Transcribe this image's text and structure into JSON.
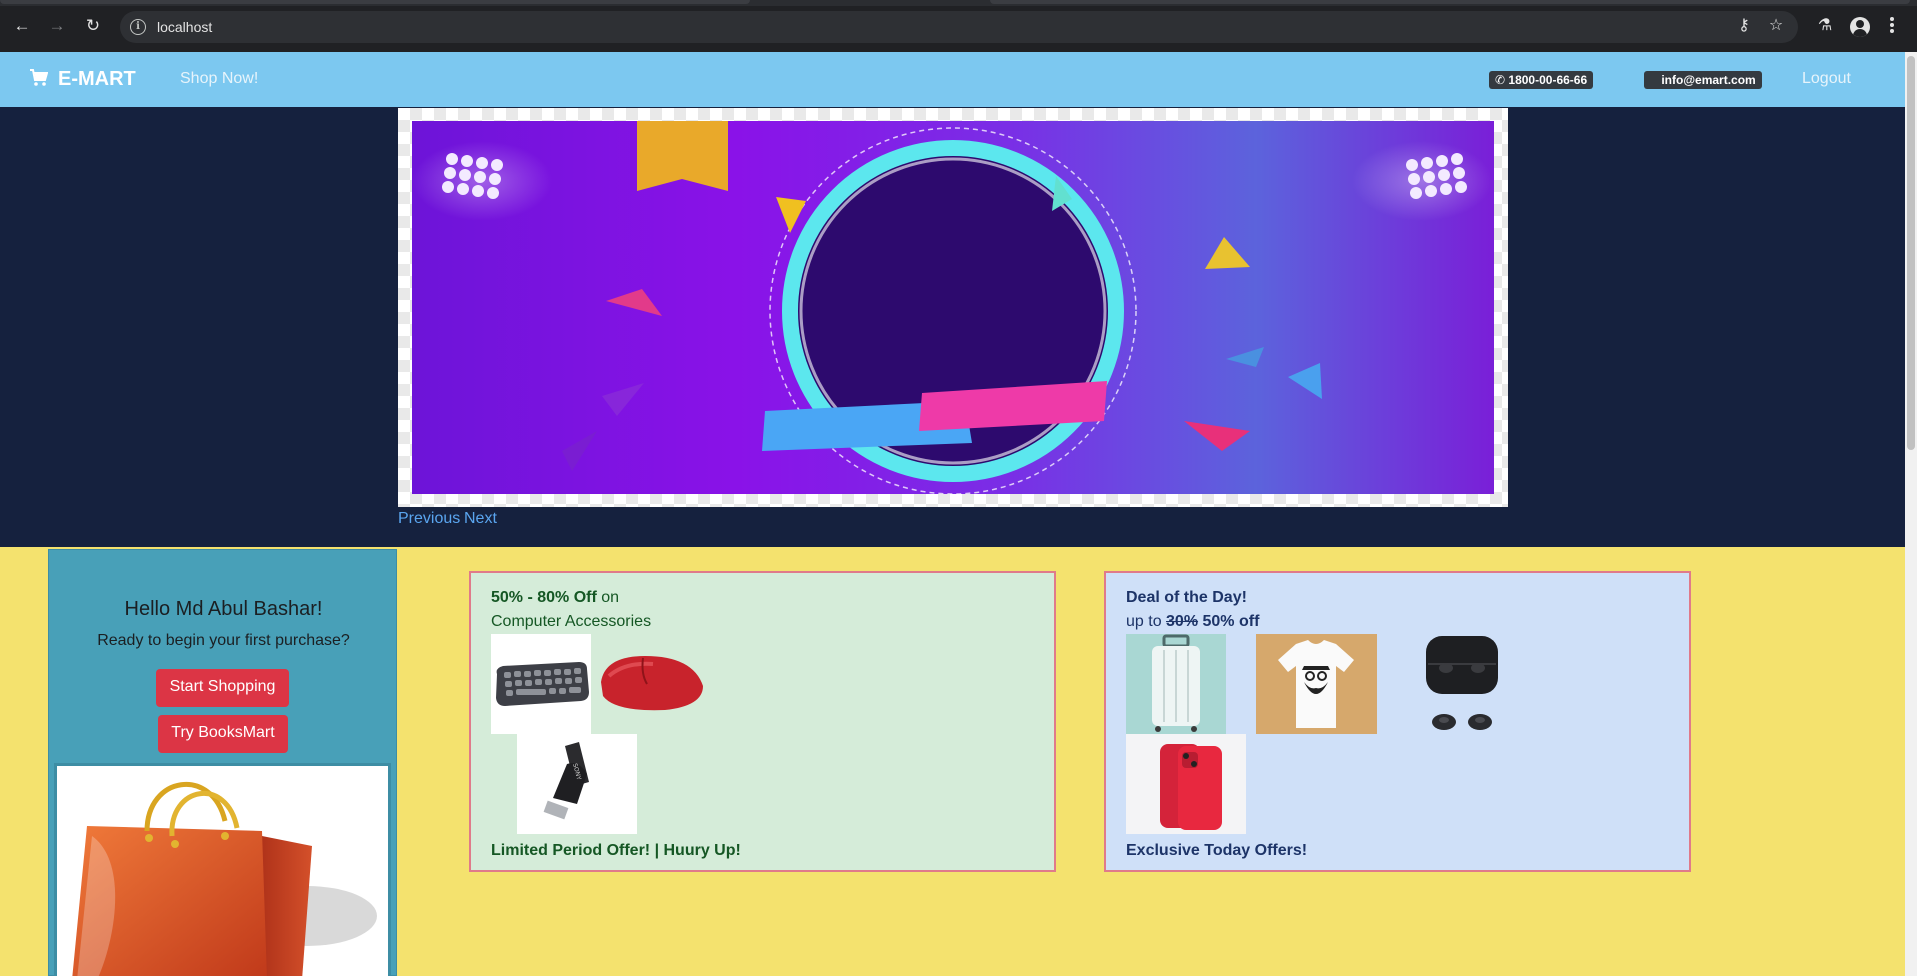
{
  "browser": {
    "url": "localhost"
  },
  "navbar": {
    "brand": "E-MART",
    "shop_link": "Shop Now!",
    "phone": "1800-00-66-66",
    "email": "info@emart.com",
    "logout": "Logout"
  },
  "carousel": {
    "previous": "Previous",
    "next": "Next"
  },
  "sidebar": {
    "greeting": "Hello Md Abul Bashar!",
    "subtitle": "Ready to begin your first purchase?",
    "start_shopping": "Start Shopping",
    "try_booksmart": "Try BooksMart"
  },
  "offer_left": {
    "discount": "50% - 80% Off",
    "on": " on",
    "category": "Computer Accessories",
    "footer": "Limited Period Offer! | Huury Up!"
  },
  "offer_right": {
    "title": "Deal of the Day!",
    "upto": "up to ",
    "old_discount": "30%",
    "new_discount": " 50% off",
    "footer": "Exclusive Today Offers!"
  },
  "colors": {
    "navbar": "#7cc8f0",
    "hero_bg": "#15213e",
    "page_bg": "#f4e26e",
    "sidebar": "#48a0b8",
    "button_red": "#dc3545",
    "offer_green": "#d5ecd9",
    "offer_blue": "#cfe0f8"
  }
}
